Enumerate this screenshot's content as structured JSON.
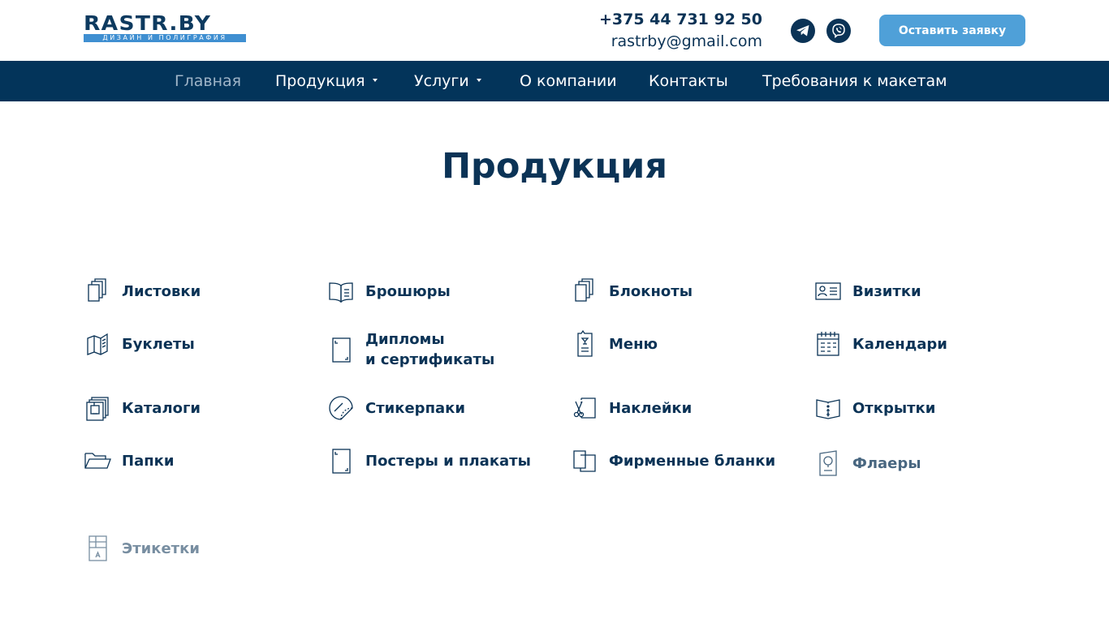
{
  "header": {
    "logo_text": "RASTR.BY",
    "logo_tagline": "ДИЗАЙН И ПОЛИГРАФИЯ",
    "phone": "+375 44 731 92 50",
    "email": "rastrby@gmail.com",
    "social": [
      {
        "icon": "telegram-icon"
      },
      {
        "icon": "viber-icon"
      }
    ],
    "cta_label": "Оставить заявку"
  },
  "nav": {
    "items": [
      {
        "label": "Главная",
        "active": true
      },
      {
        "label": "Продукция",
        "has_dropdown": true
      },
      {
        "label": "Услуги",
        "has_dropdown": true
      },
      {
        "label": "О компании"
      },
      {
        "label": "Контакты"
      },
      {
        "label": "Требования к макетам"
      }
    ]
  },
  "main": {
    "title": "Продукция",
    "categories": [
      {
        "label": "Листовки",
        "icon": "pages-icon"
      },
      {
        "label": "Брошюры",
        "icon": "open-book-icon"
      },
      {
        "label": "Блокноты",
        "icon": "notepad-icon"
      },
      {
        "label": "Визитки",
        "icon": "business-card-icon"
      },
      {
        "label": "Буклеты",
        "icon": "folded-booklet-icon"
      },
      {
        "label": "Дипломы\nи сертификаты",
        "icon": "diploma-icon"
      },
      {
        "label": "Меню",
        "icon": "menu-card-icon"
      },
      {
        "label": "Календари",
        "icon": "calendar-icon"
      },
      {
        "label": "Каталоги",
        "icon": "catalog-icon"
      },
      {
        "label": "Стикерпаки",
        "icon": "sticker-icon"
      },
      {
        "label": "Наклейки",
        "icon": "scissors-sticker-icon"
      },
      {
        "label": "Открытки",
        "icon": "postcard-icon"
      },
      {
        "label": "Папки",
        "icon": "folder-icon"
      },
      {
        "label": "Постеры и плакаты",
        "icon": "poster-icon"
      },
      {
        "label": "Фирменные бланки",
        "icon": "letterhead-icon"
      },
      {
        "label": "Флаеры",
        "icon": "flyer-icon"
      },
      {
        "label": "Этикетки",
        "icon": "label-icon"
      }
    ]
  },
  "colors": {
    "primary_dark": "#03345a",
    "text": "#0b3356",
    "accent": "#4fa0d8",
    "nav_active": "#9fb5c8"
  }
}
